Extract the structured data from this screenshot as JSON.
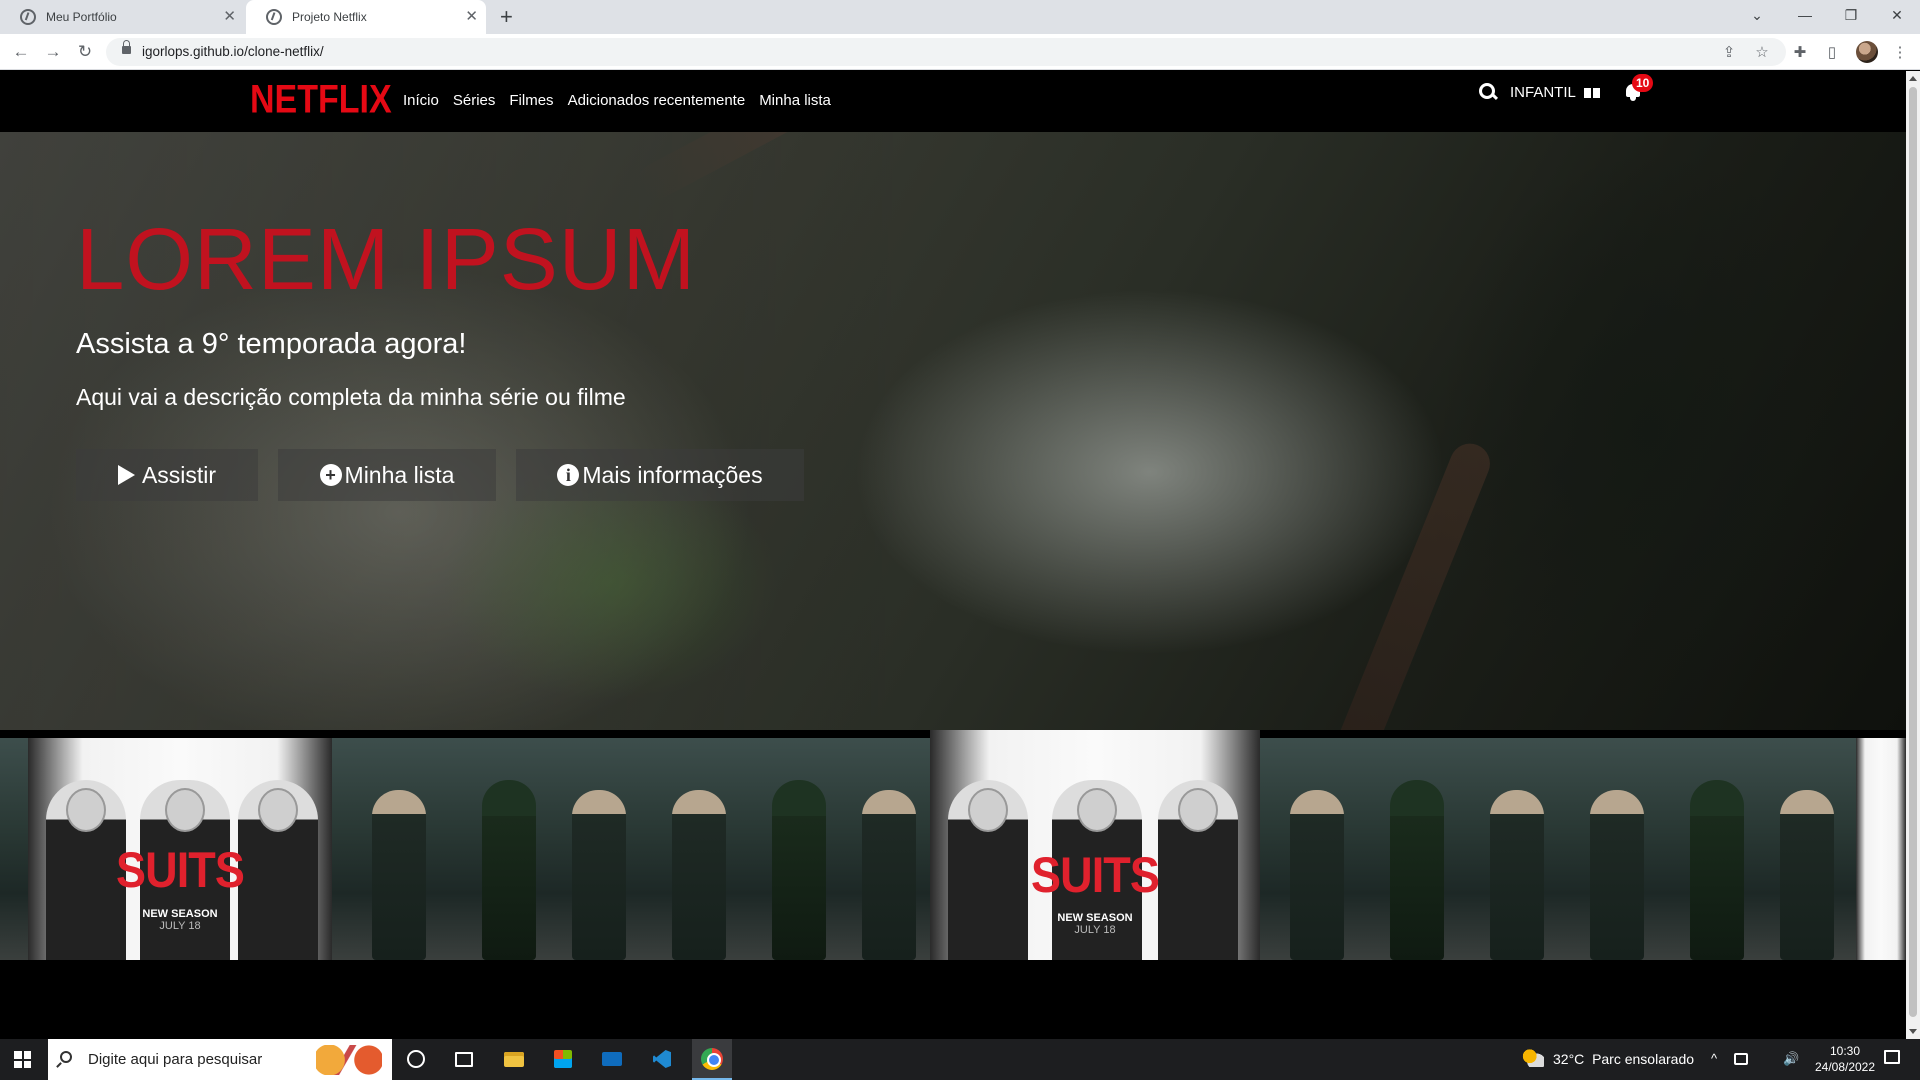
{
  "browser": {
    "tabs": [
      {
        "title": "Meu Portfólio",
        "active": false
      },
      {
        "title": "Projeto Netflix",
        "active": true
      }
    ],
    "tab_close_glyph": "✕",
    "new_tab_glyph": "+",
    "url": "igorlops.github.io/clone-netflix/",
    "icons": {
      "back": "←",
      "forward": "→",
      "reload": "↻",
      "share": "⇪",
      "star": "☆",
      "extensions": "✚",
      "side_panel": "▯",
      "menu": "⋮",
      "tab_search": "⌄",
      "minimize": "—",
      "maximize": "❐",
      "close": "✕"
    }
  },
  "netflix": {
    "logo": "NETFLIX",
    "nav": [
      "Início",
      "Séries",
      "Filmes",
      "Adicionados recentemente",
      "Minha lista"
    ],
    "profile_label": "INFANTIL",
    "notification_count": "10",
    "accent_color": "#e50914"
  },
  "hero": {
    "title": "LOREM IPSUM",
    "subtitle": "Assista a 9° temporada agora!",
    "description": "Aqui vai a descrição completa da minha série ou filme",
    "buttons": {
      "watch": "Assistir",
      "my_list": "Minha lista",
      "more_info": "Mais informações"
    },
    "icons": {
      "plus": "+",
      "info": "i"
    }
  },
  "posters": {
    "suits_logo": "SUITS",
    "suits_tagline": "NEW SEASON",
    "suits_date": "JULY 18"
  },
  "taskbar": {
    "search_placeholder": "Digite aqui para pesquisar",
    "weather_temp": "32°C",
    "weather_desc": "Parc ensolarado",
    "time": "10:30",
    "date": "24/08/2022",
    "tray_up_glyph": "^",
    "volume_glyph": "🔊"
  }
}
